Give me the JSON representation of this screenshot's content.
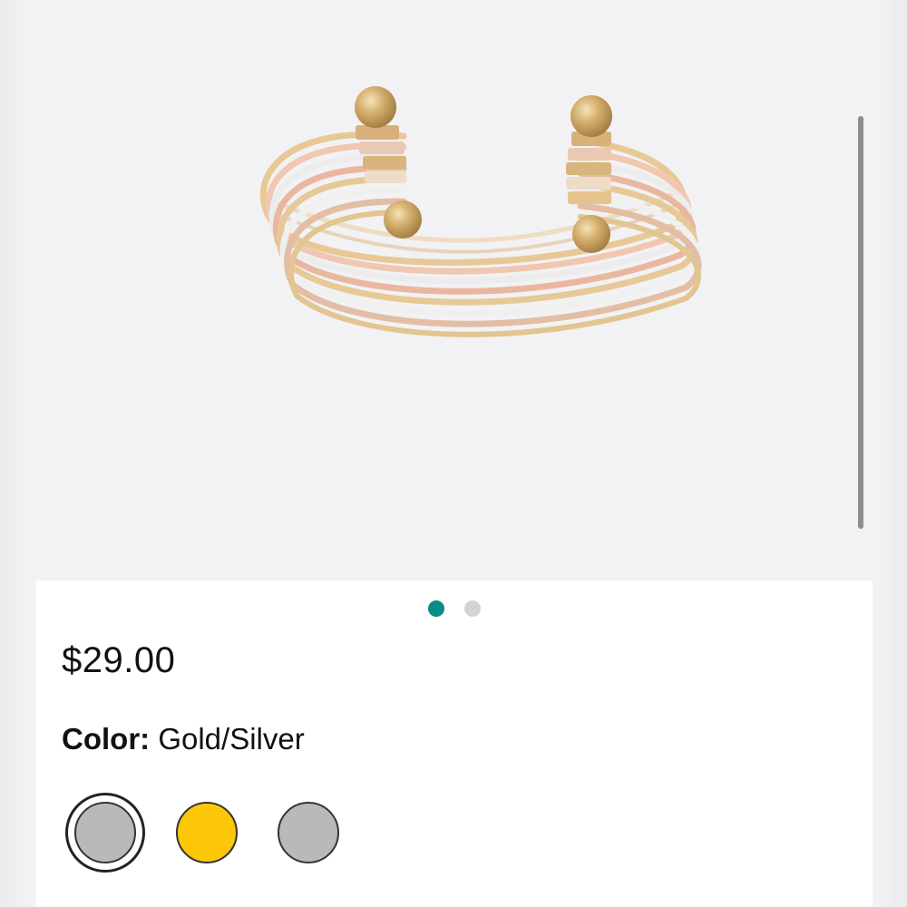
{
  "product": {
    "image_alt": "Layered cuff bracelet",
    "gallery": {
      "image_count": 2,
      "active_index": 0,
      "active_dot_color": "#0c8a87",
      "inactive_dot_color": "#d3d3d6"
    },
    "price": "$29.00",
    "color": {
      "label": "Color:",
      "selected_value": "Gold/Silver"
    },
    "swatches": [
      {
        "color": "#b9b9b9",
        "selected": true
      },
      {
        "color": "#fcc707",
        "selected": false
      },
      {
        "color": "#b9b9b9",
        "selected": false
      }
    ]
  }
}
